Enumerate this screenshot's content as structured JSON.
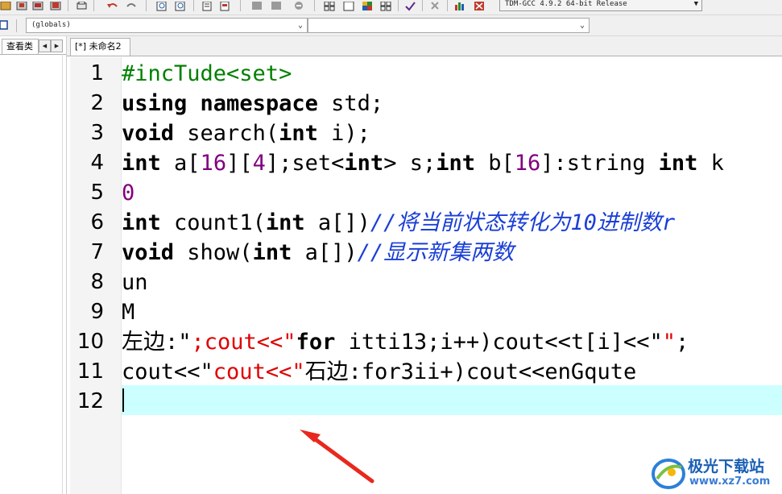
{
  "toolbar": {
    "compiler_select": "TDM-GCC 4.9.2 64-bit Release"
  },
  "navbar": {
    "scope_select": "(globals)",
    "member_select": ""
  },
  "left_panel": {
    "tab_label": "查看类"
  },
  "editor": {
    "tab_label": "[*] 未命名2",
    "line_numbers": [
      "1",
      "2",
      "3",
      "4",
      "5",
      "6",
      "7",
      "8",
      "9",
      "10",
      "11",
      "12"
    ],
    "lines": {
      "l1": {
        "a": "#incTude<set>"
      },
      "l2": {
        "a": "using",
        "b": " ",
        "c": "namespace",
        "d": " std;"
      },
      "l3": {
        "a": "void",
        "b": " search(",
        "c": "int",
        "d": " i);"
      },
      "l4": {
        "a": "int",
        "b": " a[",
        "c": "16",
        "d": "][",
        "e": "4",
        "f": "];set<",
        "g": "int",
        "h": "> s;",
        "i": "int",
        "j": " b[",
        "k": "16",
        "l": "]:string ",
        "m": "int",
        "n": " k"
      },
      "l5": {
        "a": "0"
      },
      "l6": {
        "a": "int",
        "b": " count1(",
        "c": "int",
        "d": " a[])",
        "e": "//将当前状态转化为10进制数r"
      },
      "l7": {
        "a": "void",
        "b": " show(",
        "c": "int",
        "d": " a[])",
        "e": "//显示新集两数"
      },
      "l8": {
        "a": "un"
      },
      "l9": {
        "a": "M"
      },
      "l10": {
        "a": "左边:\"",
        "b": ";cout<<\"",
        "c": "for",
        "d": " itti13;i++)cout<<t[i]<<\"",
        "e": "\"",
        "f": ";"
      },
      "l11": {
        "a": "cout<<\"",
        "b": "cout<<\"",
        "c": "石边:for3ii+)cout<<enGqute"
      },
      "l12": {
        "a": ""
      }
    }
  },
  "watermark": {
    "title": "极光下载站",
    "url": "www.xz7.com"
  },
  "colors": {
    "keyword": "#000000",
    "number": "#800080",
    "string": "#e00000",
    "comment": "#1a3fd6",
    "directive": "#008000",
    "current_line": "#ccffff",
    "annotation_arrow": "#e8281e"
  }
}
